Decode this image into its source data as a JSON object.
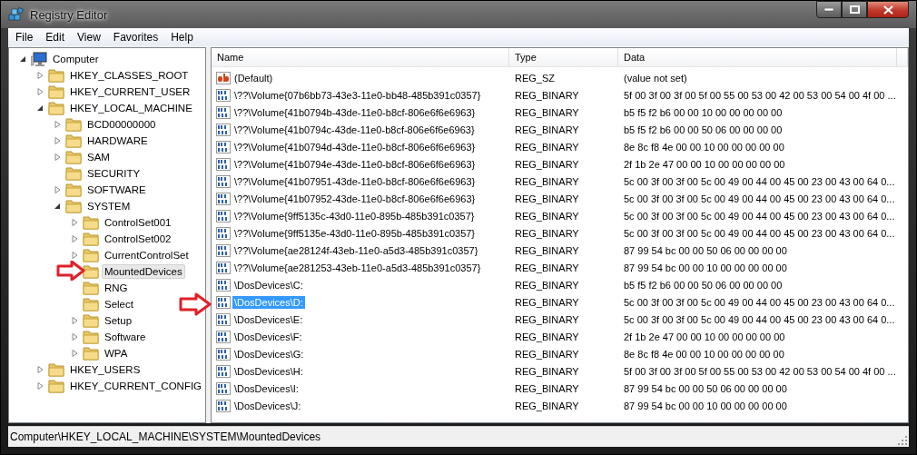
{
  "window": {
    "title": "Registry Editor"
  },
  "menu": [
    "File",
    "Edit",
    "View",
    "Favorites",
    "Help"
  ],
  "tree": {
    "items": [
      {
        "kind": "computer",
        "label": "Computer",
        "expanded": true,
        "selected": false,
        "marked": false,
        "children": [
          {
            "kind": "folder",
            "label": "HKEY_CLASSES_ROOT",
            "expanded": false,
            "selected": false,
            "marked": false
          },
          {
            "kind": "folder",
            "label": "HKEY_CURRENT_USER",
            "expanded": false,
            "selected": false,
            "marked": false
          },
          {
            "kind": "folder",
            "label": "HKEY_LOCAL_MACHINE",
            "expanded": true,
            "selected": false,
            "marked": false,
            "children": [
              {
                "kind": "folder",
                "label": "BCD00000000",
                "expanded": false,
                "selected": false,
                "marked": false
              },
              {
                "kind": "folder",
                "label": "HARDWARE",
                "expanded": false,
                "selected": false,
                "marked": false
              },
              {
                "kind": "folder",
                "label": "SAM",
                "expanded": false,
                "selected": false,
                "marked": false
              },
              {
                "kind": "leaf",
                "label": "SECURITY",
                "selected": false,
                "marked": false
              },
              {
                "kind": "folder",
                "label": "SOFTWARE",
                "expanded": false,
                "selected": false,
                "marked": false
              },
              {
                "kind": "folder",
                "label": "SYSTEM",
                "expanded": true,
                "selected": false,
                "marked": false,
                "children": [
                  {
                    "kind": "folder",
                    "label": "ControlSet001",
                    "expanded": false,
                    "selected": false,
                    "marked": false
                  },
                  {
                    "kind": "folder",
                    "label": "ControlSet002",
                    "expanded": false,
                    "selected": false,
                    "marked": false
                  },
                  {
                    "kind": "folder",
                    "label": "CurrentControlSet",
                    "expanded": false,
                    "selected": false,
                    "marked": false
                  },
                  {
                    "kind": "leaf",
                    "label": "MountedDevices",
                    "selected": true,
                    "marked": true
                  },
                  {
                    "kind": "leaf",
                    "label": "RNG",
                    "selected": false,
                    "marked": false
                  },
                  {
                    "kind": "leaf",
                    "label": "Select",
                    "selected": false,
                    "marked": false
                  },
                  {
                    "kind": "folder",
                    "label": "Setup",
                    "expanded": false,
                    "selected": false,
                    "marked": false
                  },
                  {
                    "kind": "folder",
                    "label": "Software",
                    "expanded": false,
                    "selected": false,
                    "marked": false
                  },
                  {
                    "kind": "folder",
                    "label": "WPA",
                    "expanded": false,
                    "selected": false,
                    "marked": false
                  }
                ]
              }
            ]
          },
          {
            "kind": "folder",
            "label": "HKEY_USERS",
            "expanded": false,
            "selected": false,
            "marked": false
          },
          {
            "kind": "folder",
            "label": "HKEY_CURRENT_CONFIG",
            "expanded": false,
            "selected": false,
            "marked": false
          }
        ]
      }
    ]
  },
  "table": {
    "columns": [
      "Name",
      "Type",
      "Data"
    ],
    "rows": [
      {
        "kind": "string",
        "name": "(Default)",
        "type": "REG_SZ",
        "data": "(value not set)",
        "selected": false,
        "marked": false
      },
      {
        "kind": "binary",
        "name": "\\??\\Volume{07b6bb73-43e3-11e0-bb48-485b391c0357}",
        "type": "REG_BINARY",
        "data": "5f 00 3f 00 3f 00 5f 00 55 00 53 00 42 00 53 00 54 00 4f 00 ...",
        "selected": false,
        "marked": false
      },
      {
        "kind": "binary",
        "name": "\\??\\Volume{41b0794b-43de-11e0-b8cf-806e6f6e6963}",
        "type": "REG_BINARY",
        "data": "b5 f5 f2 b6 00 00 10 00 00 00 00 00",
        "selected": false,
        "marked": false
      },
      {
        "kind": "binary",
        "name": "\\??\\Volume{41b0794c-43de-11e0-b8cf-806e6f6e6963}",
        "type": "REG_BINARY",
        "data": "b5 f5 f2 b6 00 00 50 06 00 00 00 00",
        "selected": false,
        "marked": false
      },
      {
        "kind": "binary",
        "name": "\\??\\Volume{41b0794d-43de-11e0-b8cf-806e6f6e6963}",
        "type": "REG_BINARY",
        "data": "8e 8c f8 4e 00 00 10 00 00 00 00 00",
        "selected": false,
        "marked": false
      },
      {
        "kind": "binary",
        "name": "\\??\\Volume{41b0794e-43de-11e0-b8cf-806e6f6e6963}",
        "type": "REG_BINARY",
        "data": "2f 1b 2e 47 00 00 10 00 00 00 00 00",
        "selected": false,
        "marked": false
      },
      {
        "kind": "binary",
        "name": "\\??\\Volume{41b07951-43de-11e0-b8cf-806e6f6e6963}",
        "type": "REG_BINARY",
        "data": "5c 00 3f 00 3f 00 5c 00 49 00 44 00 45 00 23 00 43 00 64 0...",
        "selected": false,
        "marked": false
      },
      {
        "kind": "binary",
        "name": "\\??\\Volume{41b07952-43de-11e0-b8cf-806e6f6e6963}",
        "type": "REG_BINARY",
        "data": "5c 00 3f 00 3f 00 5c 00 49 00 44 00 45 00 23 00 43 00 64 0...",
        "selected": false,
        "marked": false
      },
      {
        "kind": "binary",
        "name": "\\??\\Volume{9ff5135c-43d0-11e0-895b-485b391c0357}",
        "type": "REG_BINARY",
        "data": "5c 00 3f 00 3f 00 5c 00 49 00 44 00 45 00 23 00 43 00 64 0...",
        "selected": false,
        "marked": false
      },
      {
        "kind": "binary",
        "name": "\\??\\Volume{9ff5135e-43d0-11e0-895b-485b391c0357}",
        "type": "REG_BINARY",
        "data": "5c 00 3f 00 3f 00 5c 00 49 00 44 00 45 00 23 00 43 00 64 0...",
        "selected": false,
        "marked": false
      },
      {
        "kind": "binary",
        "name": "\\??\\Volume{ae28124f-43eb-11e0-a5d3-485b391c0357}",
        "type": "REG_BINARY",
        "data": "87 99 54 bc 00 00 50 06 00 00 00 00",
        "selected": false,
        "marked": false
      },
      {
        "kind": "binary",
        "name": "\\??\\Volume{ae281253-43eb-11e0-a5d3-485b391c0357}",
        "type": "REG_BINARY",
        "data": "87 99 54 bc 00 00 10 00 00 00 00 00",
        "selected": false,
        "marked": false
      },
      {
        "kind": "binary",
        "name": "\\DosDevices\\C:",
        "type": "REG_BINARY",
        "data": "b5 f5 f2 b6 00 00 50 06 00 00 00 00",
        "selected": false,
        "marked": false
      },
      {
        "kind": "binary",
        "name": "\\DosDevices\\D:",
        "type": "REG_BINARY",
        "data": "5c 00 3f 00 3f 00 5c 00 49 00 44 00 45 00 23 00 43 00 64 0...",
        "selected": true,
        "marked": true
      },
      {
        "kind": "binary",
        "name": "\\DosDevices\\E:",
        "type": "REG_BINARY",
        "data": "5c 00 3f 00 3f 00 5c 00 49 00 44 00 45 00 23 00 43 00 64 0...",
        "selected": false,
        "marked": false
      },
      {
        "kind": "binary",
        "name": "\\DosDevices\\F:",
        "type": "REG_BINARY",
        "data": "2f 1b 2e 47 00 00 10 00 00 00 00 00",
        "selected": false,
        "marked": false
      },
      {
        "kind": "binary",
        "name": "\\DosDevices\\G:",
        "type": "REG_BINARY",
        "data": "8e 8c f8 4e 00 00 10 00 00 00 00 00",
        "selected": false,
        "marked": false
      },
      {
        "kind": "binary",
        "name": "\\DosDevices\\H:",
        "type": "REG_BINARY",
        "data": "5f 00 3f 00 3f 00 5f 00 55 00 53 00 42 00 53 00 54 00 4f 00 ...",
        "selected": false,
        "marked": false
      },
      {
        "kind": "binary",
        "name": "\\DosDevices\\I:",
        "type": "REG_BINARY",
        "data": "87 99 54 bc 00 00 50 06 00 00 00 00",
        "selected": false,
        "marked": false
      },
      {
        "kind": "binary",
        "name": "\\DosDevices\\J:",
        "type": "REG_BINARY",
        "data": "87 99 54 bc 00 00 10 00 00 00 00 00",
        "selected": false,
        "marked": false
      }
    ]
  },
  "status_bar": "Computer\\HKEY_LOCAL_MACHINE\\SYSTEM\\MountedDevices"
}
